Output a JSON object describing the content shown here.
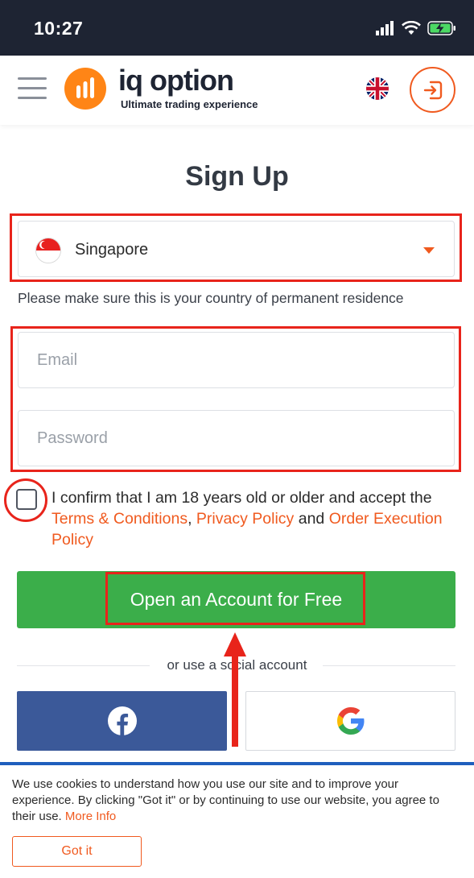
{
  "status_bar": {
    "time": "10:27"
  },
  "header": {
    "logo_name": "iq option",
    "logo_tagline": "Ultimate trading experience",
    "language_icon": "uk-flag-icon",
    "login_icon": "sign-in-icon"
  },
  "form": {
    "title": "Sign Up",
    "country": "Singapore",
    "country_flag": "singapore-flag-icon",
    "residence_note": "Please make sure this is your country of permanent residence",
    "email_placeholder": "Email",
    "password_placeholder": "Password",
    "consent_prefix": "I confirm that I am 18 years old or older and accept the",
    "terms_link": "Terms & Conditions",
    "comma": ",",
    "privacy_link": "Privacy Policy",
    "and": "and",
    "order_link": "Order Execution Policy",
    "submit_label": "Open an Account for Free",
    "social_divider": "or use a social account"
  },
  "social": {
    "facebook_icon": "facebook-icon",
    "google_icon": "google-icon"
  },
  "cookie": {
    "text": "We use cookies to understand how you use our site and to improve your experience. By clicking \"Got it\" or by continuing to use our website, you agree to their use.",
    "more_info": "More Info",
    "button_label": "Got it"
  },
  "colors": {
    "accent_orange": "#f05a1f",
    "cta_green": "#3bae4a",
    "facebook_blue": "#3b5999",
    "annotation_red": "#e8241b"
  }
}
